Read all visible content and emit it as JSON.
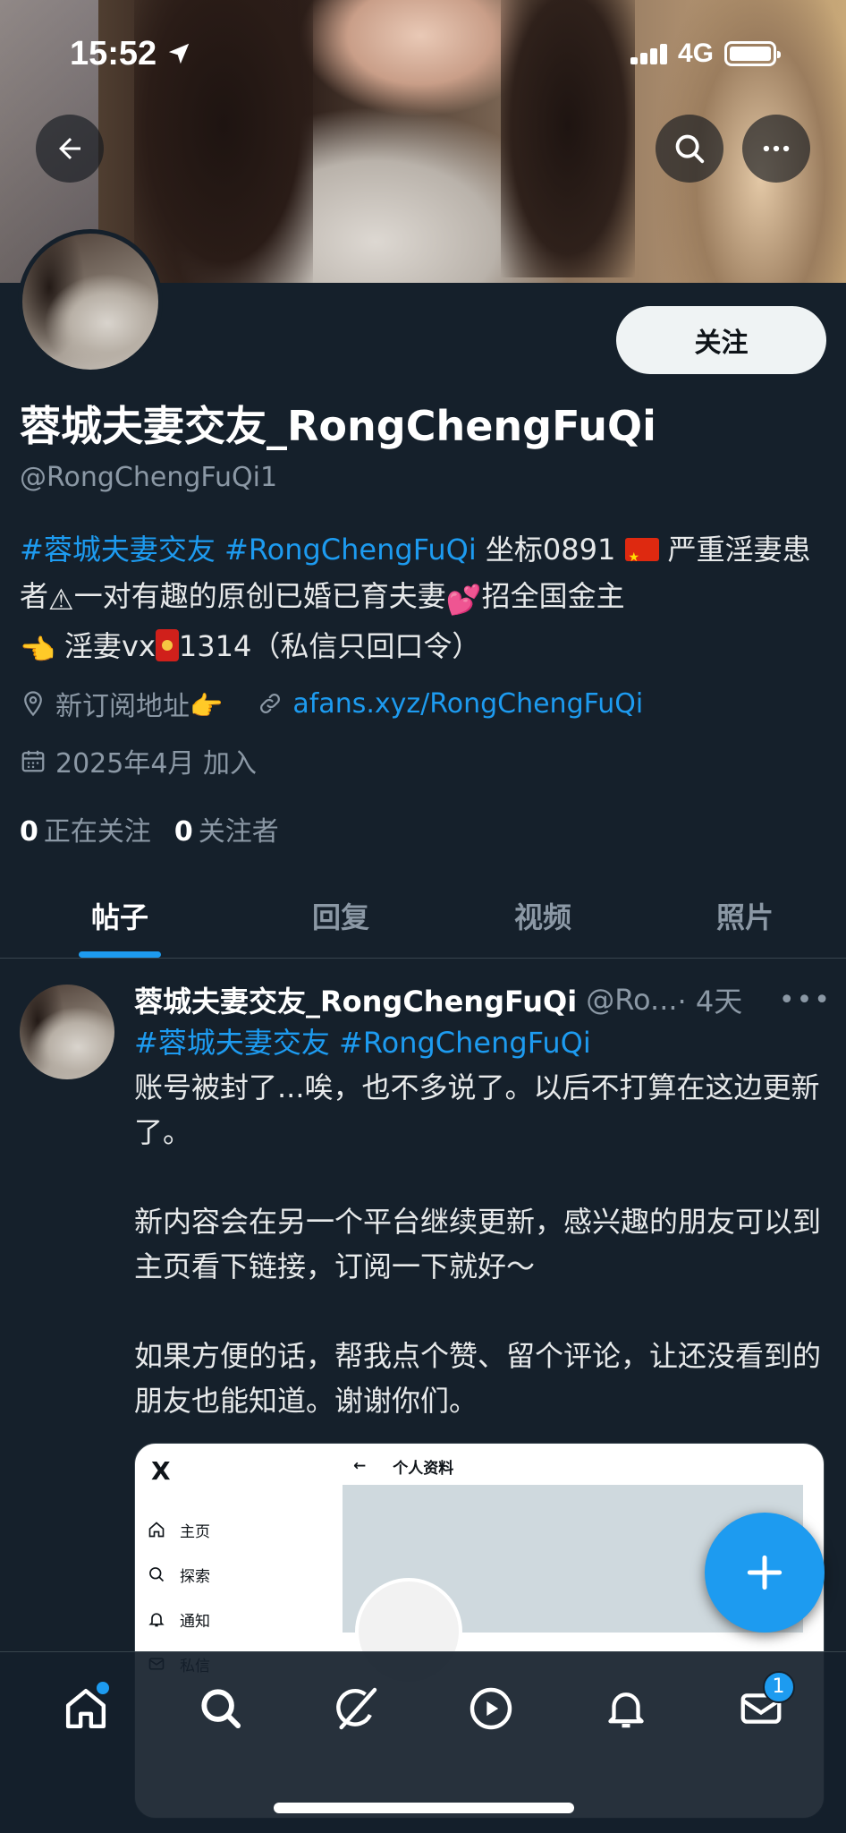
{
  "status_bar": {
    "time": "15:52",
    "network": "4G"
  },
  "header": {
    "back_icon": "back-arrow-icon",
    "search_icon": "search-icon",
    "more_icon": "more-horizontal-icon"
  },
  "profile": {
    "follow_label": "关注",
    "name": "蓉城夫妻交友_RongChengFuQi",
    "handle": "@RongChengFuQi1",
    "bio": {
      "tag1": "#蓉城夫妻交友",
      "tag2": "#RongChengFuQi",
      "part1": " 坐标0891",
      "part2": "严重淫妻患者",
      "part3": "一对有趣的原创已婚已育夫妻",
      "part4": "招全国金主",
      "part5": "淫妻vx",
      "part6": "1314（私信只回口令）"
    },
    "location": "新订阅地址👉",
    "link": "afans.xyz/RongChengFuQi",
    "joined": "2025年4月 加入",
    "following_count": "0",
    "following_label": "正在关注",
    "followers_count": "0",
    "followers_label": "关注者"
  },
  "tabs": [
    {
      "label": "帖子",
      "active": true
    },
    {
      "label": "回复",
      "active": false
    },
    {
      "label": "视频",
      "active": false
    },
    {
      "label": "照片",
      "active": false
    }
  ],
  "post": {
    "author_name": "蓉城夫妻交友_RongChengFuQi",
    "author_handle": "@Ro...",
    "time": "· 4天",
    "more": "•••",
    "tag1": "#蓉城夫妻交友",
    "tag2": "#RongChengFuQi",
    "para1": "账号被封了...唉，也不多说了。以后不打算在这边更新了。",
    "para2": "新内容会在另一个平台继续更新，感兴趣的朋友可以到主页看下链接，订阅一下就好～",
    "para3": "如果方便的话，帮我点个赞、留个评论，让还没看到的朋友也能知道。谢谢你们。",
    "media": {
      "logo": "X",
      "sidebar": [
        "主页",
        "探索",
        "通知",
        "私信"
      ],
      "title": "个人资料"
    }
  },
  "bottom_nav": {
    "items": [
      "home-icon",
      "search-icon",
      "grok-icon",
      "video-icon",
      "notifications-icon",
      "messages-icon"
    ],
    "messages_badge": "1"
  },
  "colors": {
    "background": "#15202b",
    "accent": "#1d9bf0",
    "text_secondary": "#8b98a5"
  }
}
